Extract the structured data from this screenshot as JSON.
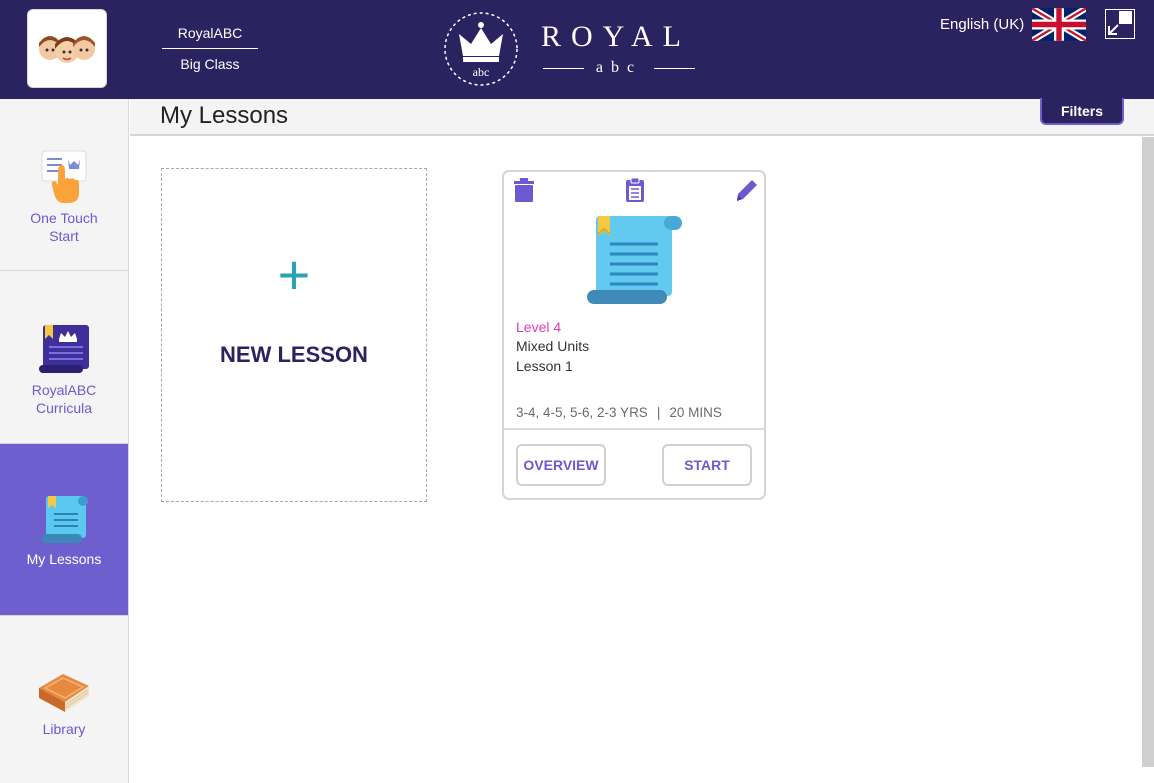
{
  "header": {
    "org_name": "RoyalABC",
    "class_name": "Big Class",
    "brand_name": "ROYAL",
    "brand_sub": "abc",
    "crest_text": "abc",
    "language": "English (UK)",
    "colors": {
      "header_bg": "#2b2260",
      "accent": "#6f5fce"
    },
    "icons": {
      "avatar": "kids-avatar-icon",
      "flag": "uk-flag-icon",
      "expand": "exit-fullscreen-icon"
    }
  },
  "sidebar": {
    "items": [
      {
        "label_line1": "One Touch",
        "label_line2": "Start",
        "icon": "one-touch-start-icon",
        "active": false
      },
      {
        "label_line1": "RoyalABC",
        "label_line2": "Curricula",
        "icon": "curriculum-scroll-icon",
        "active": false
      },
      {
        "label_line1": "My Lessons",
        "label_line2": "",
        "icon": "lesson-scroll-icon",
        "active": true
      },
      {
        "label_line1": "Library",
        "label_line2": "",
        "icon": "book-icon",
        "active": false
      }
    ]
  },
  "main": {
    "title": "My Lessons",
    "filters_label": "Filters",
    "new_lesson": {
      "plus": "+",
      "label": "NEW LESSON"
    },
    "lessons": [
      {
        "level": "Level 4",
        "unit": "Mixed Units",
        "lesson": "Lesson 1",
        "ages": "3-4, 4-5, 5-6, 2-3 YRS",
        "separator": "|",
        "duration": "20 MINS",
        "overview_label": "OVERVIEW",
        "start_label": "START",
        "icons": [
          "trash-icon",
          "clipboard-icon",
          "pencil-icon",
          "lesson-scroll-icon"
        ]
      }
    ]
  }
}
